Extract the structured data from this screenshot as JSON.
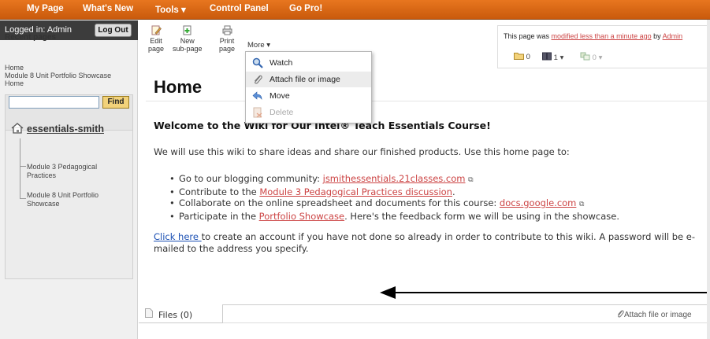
{
  "topnav": {
    "my_page": "My Page",
    "whats_new": "What's New",
    "tools": "Tools ▾",
    "control_panel": "Control Panel",
    "go_pro": "Go Pro!"
  },
  "sidebar": {
    "logged_in": "Logged in: Admin",
    "logout": "Log Out",
    "recent_title": "Recent pages",
    "recent": [
      "Home",
      "Module 8 Unit Portfolio Showcase",
      "Home"
    ],
    "find": "Find",
    "search_value": "",
    "wiki_name": "essentials-smith",
    "tree": [
      "Module 3 Pedagogical Practices",
      "Module 8 Unit Portfolio Showcase"
    ]
  },
  "toolbar": {
    "edit": [
      "Edit",
      "page"
    ],
    "new": [
      "New",
      "sub-page"
    ],
    "print": [
      "Print",
      "page"
    ],
    "more": "More ▾"
  },
  "dropdown": {
    "watch": "Watch",
    "attach": "Attach file or image",
    "move": "Move",
    "delete": "Delete"
  },
  "pageinfo": {
    "prefix": "This page was ",
    "modified": "modified less than a minute ago",
    "by": " by ",
    "user": "Admin",
    "folders": "0",
    "pages": "1 ▾",
    "links": "0 ▾"
  },
  "content": {
    "title": "Home",
    "welcome": "Welcome to the Wiki for Our Intel® Teach Essentials Course!",
    "intro": "We will use this wiki to share ideas and share our finished products. Use this home page to:",
    "b1_text": "Go to our blogging community: ",
    "b1_link": "jsmithessentials.21classes.com",
    "b2_text": "Contribute to the ",
    "b2_link": "Module 3 Pedagogical Practices discussion",
    "b2_end": ".",
    "b3_text": "Collaborate on the online spreadsheet and documents for this course: ",
    "b3_link": "docs.google.com",
    "b4_text": "Participate in the ",
    "b4_link": "Portfolio Showcase",
    "b4_end": ". Here's the feedback form we will be using in the showcase.",
    "para_link": "Click here ",
    "para_text": "to create an account if you have not done so already in order to contribute to this wiki. A password will be e-mailed to the address you specify."
  },
  "files": {
    "tab": "Files (0)",
    "attach": "Attach file or image"
  },
  "colors": {
    "nav": "#e07020",
    "link": "#c44444",
    "find": "#f2d27a"
  }
}
